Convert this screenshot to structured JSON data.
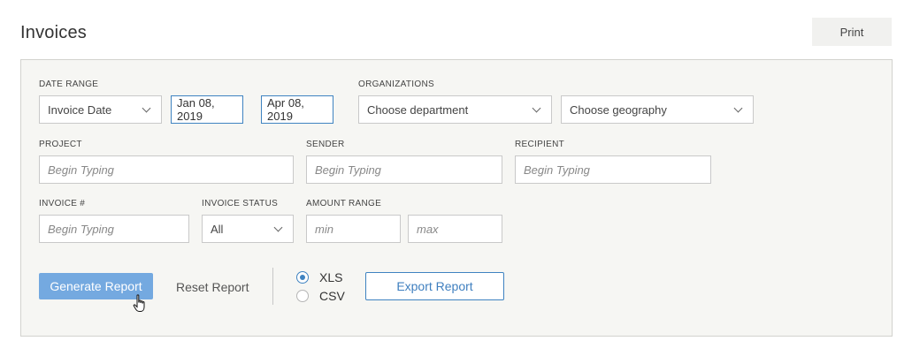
{
  "page": {
    "title": "Invoices",
    "print_label": "Print"
  },
  "filters": {
    "date_range": {
      "label": "DATE RANGE",
      "type_value": "Invoice Date",
      "start": "Jan 08, 2019",
      "end": "Apr 08, 2019"
    },
    "organizations": {
      "label": "ORGANIZATIONS",
      "department_value": "Choose department",
      "geography_value": "Choose geography"
    },
    "project": {
      "label": "PROJECT",
      "placeholder": "Begin Typing"
    },
    "sender": {
      "label": "SENDER",
      "placeholder": "Begin Typing"
    },
    "recipient": {
      "label": "RECIPIENT",
      "placeholder": "Begin Typing"
    },
    "invoice_number": {
      "label": "INVOICE #",
      "placeholder": "Begin Typing"
    },
    "invoice_status": {
      "label": "INVOICE STATUS",
      "value": "All"
    },
    "amount_range": {
      "label": "AMOUNT RANGE",
      "min_placeholder": "min",
      "max_placeholder": "max"
    }
  },
  "actions": {
    "generate_label": "Generate Report",
    "reset_label": "Reset Report",
    "formats": [
      {
        "label": "XLS",
        "selected": true
      },
      {
        "label": "CSV",
        "selected": false
      }
    ],
    "export_label": "Export Report"
  },
  "colors": {
    "accent": "#3f83c1",
    "primary_button": "#74a9e0",
    "panel_bg": "#f6f6f3"
  }
}
